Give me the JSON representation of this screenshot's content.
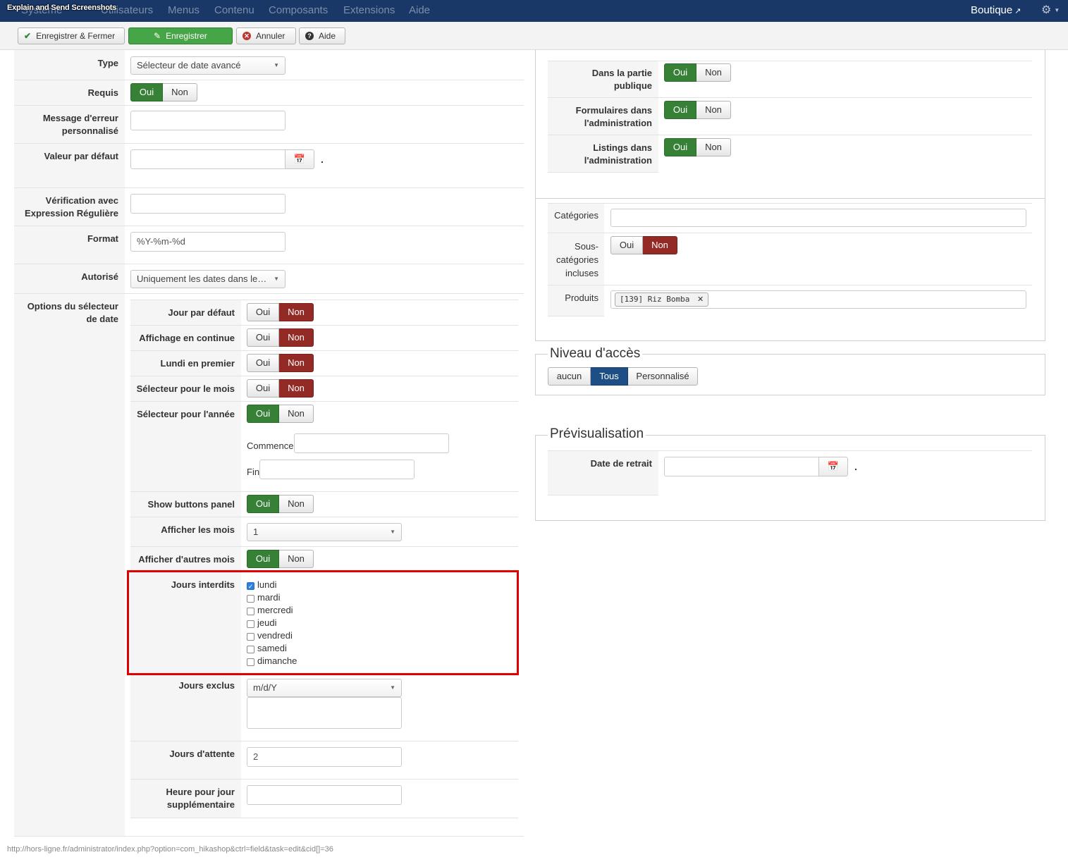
{
  "overlay_title": "Explain and Send Screenshots",
  "nav": {
    "items": [
      "Système",
      "Utilisateurs",
      "Menus",
      "Contenu",
      "Composants",
      "Extensions",
      "Aide"
    ],
    "right_link": "Boutique"
  },
  "toolbar": {
    "save_close": "Enregistrer & Fermer",
    "save": "Enregistrer",
    "cancel": "Annuler",
    "help": "Aide"
  },
  "yes": "Oui",
  "no": "Non",
  "left": {
    "type_label": "Type",
    "type_value": "Sélecteur de date avancé",
    "required_label": "Requis",
    "error_msg_label_1": "Message d'erreur",
    "error_msg_label_2": "personnalisé",
    "default_label": "Valeur par défaut",
    "regex_label_1": "Vérification avec",
    "regex_label_2": "Expression Régulière",
    "format_label": "Format",
    "format_value": "%Y-%m-%d",
    "allowed_label": "Autorisé",
    "allowed_value": "Uniquement les dates dans le…",
    "options_label_1": "Options du sélecteur",
    "options_label_2": "de date",
    "options": {
      "default_day": "Jour par défaut",
      "continuous": "Affichage en continue",
      "monday_first": "Lundi en premier",
      "month_picker": "Sélecteur pour le mois",
      "year_picker": "Sélecteur pour l'année",
      "starts": "Commence",
      "end": "Fin",
      "show_buttons": "Show buttons panel",
      "show_months": "Afficher les mois",
      "show_months_value": "1",
      "other_months": "Afficher d'autres mois",
      "forbidden_days": "Jours interdits",
      "days": [
        "lundi",
        "mardi",
        "mercredi",
        "jeudi",
        "vendredi",
        "samedi",
        "dimanche"
      ],
      "days_checked": [
        true,
        false,
        false,
        false,
        false,
        false,
        false
      ],
      "excluded_days": "Jours exclus",
      "excluded_format": "m/d/Y",
      "waiting_days": "Jours d'attente",
      "waiting_value": "2",
      "extra_hour_1": "Heure pour jour",
      "extra_hour_2": "supplémentaire"
    }
  },
  "right": {
    "public_label_1": "Dans la partie",
    "public_label_2": "publique",
    "admin_forms_label_1": "Formulaires dans",
    "admin_forms_label_2": "l'administration",
    "admin_listings_label_1": "Listings dans",
    "admin_listings_label_2": "l'administration",
    "categories_label": "Catégories",
    "subcats_label_1": "Sous-",
    "subcats_label_2": "catégories",
    "subcats_label_3": "incluses",
    "products_label": "Produits",
    "product_tag": "[139] Riz Bomba",
    "access_legend": "Niveau d'accès",
    "access_options": [
      "aucun",
      "Tous",
      "Personnalisé"
    ],
    "preview_legend": "Prévisualisation",
    "pickup_label": "Date de retrait"
  },
  "statusbar": "http://hors-ligne.fr/administrator/index.php?option=com_hikashop&ctrl=field&task=edit&cid[]=36",
  "colors": {
    "nav_bg": "#1a3867",
    "yes_green": "#378137",
    "no_red": "#942a25",
    "access_blue": "#1d4f86",
    "highlight": "#e00000"
  }
}
